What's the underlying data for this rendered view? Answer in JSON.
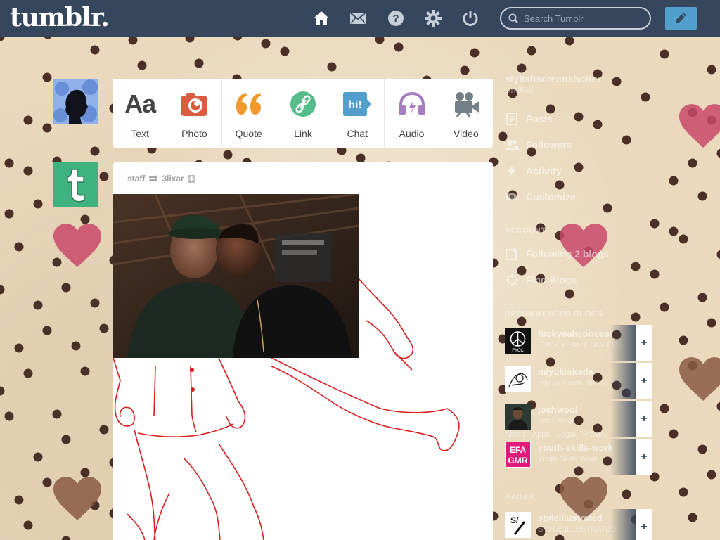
{
  "header": {
    "logo": "tumblr.",
    "search_placeholder": "Search Tumblr"
  },
  "post_types": [
    {
      "label": "Text",
      "icon": "text-icon",
      "color": "#444444"
    },
    {
      "label": "Photo",
      "icon": "camera-icon",
      "color": "#d95e40"
    },
    {
      "label": "Quote",
      "icon": "quote-icon",
      "color": "#f2992e"
    },
    {
      "label": "Link",
      "icon": "link-icon",
      "color": "#56bc8a"
    },
    {
      "label": "Chat",
      "icon": "chat-icon",
      "color": "#529ecc"
    },
    {
      "label": "Audio",
      "icon": "headphones-icon",
      "color": "#a77dc2"
    },
    {
      "label": "Video",
      "icon": "video-camera-icon",
      "color": "#748089"
    }
  ],
  "post": {
    "author": "staff",
    "reblogged_from": "3lixar"
  },
  "sidebar": {
    "username": "stylishscreenshotter",
    "subtitle": "Untitled",
    "items": [
      {
        "label": "Posts",
        "icon": "posts-icon"
      },
      {
        "label": "Followers",
        "icon": "followers-icon"
      },
      {
        "label": "Activity",
        "icon": "activity-icon"
      },
      {
        "label": "Customize",
        "icon": "eye-icon"
      }
    ],
    "account_heading": "ACCOUNT",
    "account_items": [
      {
        "label": "Following 2 blogs",
        "icon": "following-icon"
      },
      {
        "label": "Find Blogs",
        "icon": "find-blogs-icon"
      }
    ],
    "recommended_heading": "RECOMMENDED BLOGS",
    "recommended": [
      {
        "name": "fuckyeahconcept",
        "desc": "FUCK YEAH CONCEPT",
        "thumb": "FYCC"
      },
      {
        "name": "miyukiokada",
        "desc": "miyuki okada Illustra",
        "thumb": ""
      },
      {
        "name": "joshwool",
        "desc": "Josh Wool",
        "thumb": ""
      },
      {
        "name": "youth-skills-work",
        "desc": "Youth Skills Work",
        "thumb": "EFA GMR"
      }
    ],
    "radar_heading": "RADAR",
    "radar": {
      "name": "styleillustrated",
      "desc": "STYLE ILLUSTRATED",
      "thumb": "S/"
    },
    "footer_links": [
      "About",
      "Apps",
      "Legal",
      "Privacy"
    ]
  },
  "colors": {
    "topbar": "#36465d",
    "compose": "#529ecc",
    "heart_red": "#c9486a",
    "heart_brown": "#8a5a44",
    "dot": "#4a3026"
  }
}
